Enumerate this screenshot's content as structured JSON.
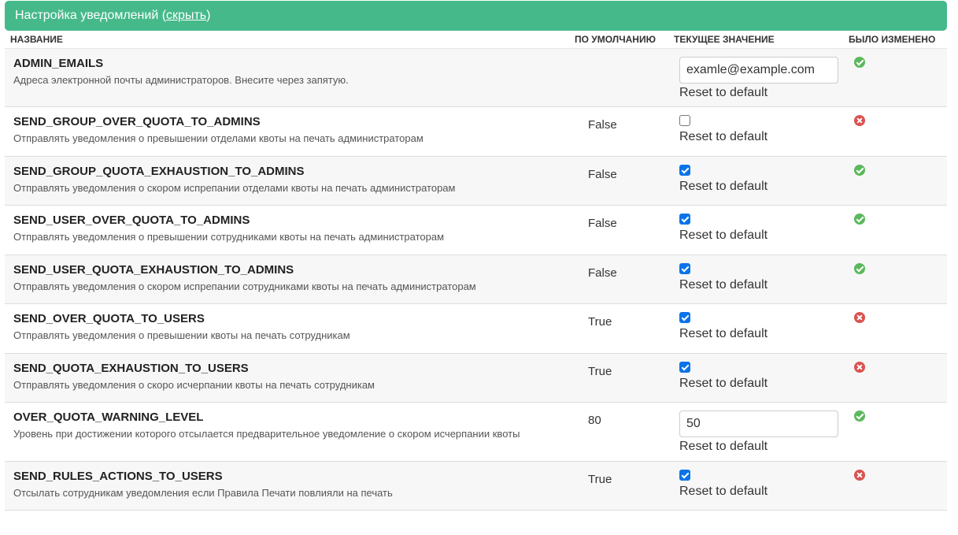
{
  "header": {
    "title": "Настройка уведомлений",
    "open_paren": " (",
    "hide_link": "скрыть",
    "close_paren": ")"
  },
  "columns": {
    "name": "НАЗВАНИЕ",
    "default": "ПО УМОЛЧАНИЮ",
    "current": "ТЕКУЩЕЕ ЗНАЧЕНИЕ",
    "changed": "БЫЛО ИЗМЕНЕНО"
  },
  "reset_label": "Reset to default",
  "rows": [
    {
      "name": "ADMIN_EMAILS",
      "desc": "Адреса электронной почты администраторов. Внесите через запятую.",
      "default": "",
      "type": "text",
      "value": "examle@example.com",
      "changed": true
    },
    {
      "name": "SEND_GROUP_OVER_QUOTA_TO_ADMINS",
      "desc": "Отправлять уведомления о превышении отделами квоты на печать администраторам",
      "default": "False",
      "type": "checkbox",
      "checked": false,
      "changed": false
    },
    {
      "name": "SEND_GROUP_QUOTA_EXHAUSTION_TO_ADMINS",
      "desc": "Отправлять уведомления о скором испрепании отделами квоты на печать администраторам",
      "default": "False",
      "type": "checkbox",
      "checked": true,
      "changed": true
    },
    {
      "name": "SEND_USER_OVER_QUOTA_TO_ADMINS",
      "desc": "Отправлять уведомления о превышении сотрудниками квоты на печать администраторам",
      "default": "False",
      "type": "checkbox",
      "checked": true,
      "changed": true
    },
    {
      "name": "SEND_USER_QUOTA_EXHAUSTION_TO_ADMINS",
      "desc": "Отправлять уведомления о скором испрепании сотрудниками квоты на печать администраторам",
      "default": "False",
      "type": "checkbox",
      "checked": true,
      "changed": true
    },
    {
      "name": "SEND_OVER_QUOTA_TO_USERS",
      "desc": "Отправлять уведомления о превышении квоты на печать сотрудникам",
      "default": "True",
      "type": "checkbox",
      "checked": true,
      "changed": false
    },
    {
      "name": "SEND_QUOTA_EXHAUSTION_TO_USERS",
      "desc": "Отправлять уведомления о скоро исчерпании квоты на печать сотрудникам",
      "default": "True",
      "type": "checkbox",
      "checked": true,
      "changed": false
    },
    {
      "name": "OVER_QUOTA_WARNING_LEVEL",
      "desc": "Уровень при достижении которого отсылается предварительное уведомление о скором исчерпании квоты",
      "default": "80",
      "type": "text",
      "value": "50",
      "changed": true
    },
    {
      "name": "SEND_RULES_ACTIONS_TO_USERS",
      "desc": "Отсылать сотрудникам уведомления если Правила Печати повлияли на печать",
      "default": "True",
      "type": "checkbox",
      "checked": true,
      "changed": false
    }
  ]
}
